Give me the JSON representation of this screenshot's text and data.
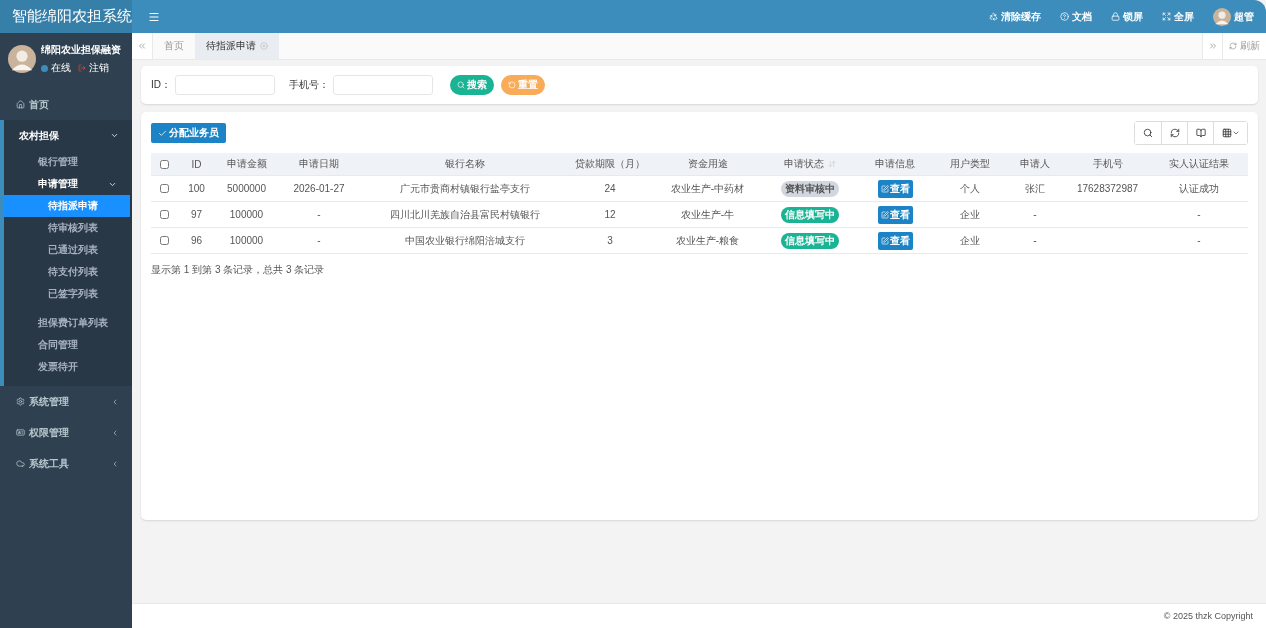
{
  "app_title": "智能绵阳农担系统",
  "topbar": {
    "items": [
      {
        "label": "清除缓存"
      },
      {
        "label": "文档"
      },
      {
        "label": "锁屏"
      },
      {
        "label": "全屏"
      }
    ],
    "user": "超管"
  },
  "sidebar": {
    "user": {
      "name": "绵阳农业担保融资",
      "status": "在线",
      "logout": "注销"
    },
    "menu": [
      {
        "label": "首页",
        "selected": false
      },
      {
        "label": "农村担保",
        "expanded": true,
        "children": [
          {
            "label": "银行管理",
            "selected": false
          },
          {
            "label": "申请管理",
            "expanded": true,
            "selected": false,
            "children": [
              {
                "label": "待指派申请",
                "selected": true
              },
              {
                "label": "待审核列表",
                "selected": false
              },
              {
                "label": "已通过列表",
                "selected": false
              },
              {
                "label": "待支付列表",
                "selected": false
              },
              {
                "label": "已签字列表",
                "selected": false
              }
            ]
          },
          {
            "label": "担保费订单列表",
            "selected": false
          },
          {
            "label": "合同管理",
            "selected": false
          },
          {
            "label": "发票待开",
            "selected": false
          }
        ]
      },
      {
        "label": "系统管理",
        "expanded": false,
        "selected": false
      },
      {
        "label": "权限管理",
        "expanded": false,
        "selected": false
      },
      {
        "label": "系统工具",
        "expanded": false,
        "selected": false
      }
    ]
  },
  "tabs": [
    {
      "label": "首页",
      "selected": false,
      "closable": false
    },
    {
      "label": "待指派申请",
      "selected": true,
      "closable": true
    }
  ],
  "refresh_label": "刷新",
  "search": {
    "fields": [
      {
        "label": "ID："
      },
      {
        "label": "手机号："
      }
    ],
    "buttons": [
      {
        "kind": "search",
        "label": "搜索"
      },
      {
        "kind": "reset",
        "label": "重置"
      }
    ]
  },
  "assign_button": "分配业务员",
  "table": {
    "all_checked": false,
    "columns": [
      "ID",
      "申请金额",
      "申请日期",
      "银行名称",
      "贷款期限（月）",
      "资金用途",
      "申请状态",
      "申请信息",
      "用户类型",
      "申请人",
      "手机号",
      "实人认证结果"
    ],
    "rows": [
      {
        "checked": false,
        "id": "100",
        "amount": "5000000",
        "date": "2026-01-27",
        "bank": "广元市贵商村镇银行盐亭支行",
        "term": "24",
        "purpose": "农业生产-中药材",
        "status": {
          "label": "资料审核中",
          "color": "#d2d6de"
        },
        "view": "查看",
        "user_type": "个人",
        "applicant": "张汇",
        "phone": "17628372987",
        "verification": "认证成功"
      },
      {
        "checked": false,
        "id": "97",
        "amount": "100000",
        "date": "-",
        "bank": "四川北川羌族自治县富民村镇银行",
        "term": "12",
        "purpose": "农业生产-牛",
        "status": {
          "label": "信息填写中",
          "color": "#1ab394"
        },
        "view": "查看",
        "user_type": "企业",
        "applicant": "-",
        "verification": "-"
      },
      {
        "checked": false,
        "id": "96",
        "amount": "100000",
        "date": "-",
        "bank": "中国农业银行绵阳涪城支行",
        "term": "3",
        "purpose": "农业生产-粮食",
        "status": {
          "label": "信息填写中",
          "color": "#1ab394"
        },
        "view": "查看",
        "user_type": "企业",
        "applicant": "-",
        "verification": "-"
      }
    ],
    "summary": "显示第 1 到第 3 条记录，总共 3 条记录"
  },
  "footer": "© 2025 thzk Copyright"
}
